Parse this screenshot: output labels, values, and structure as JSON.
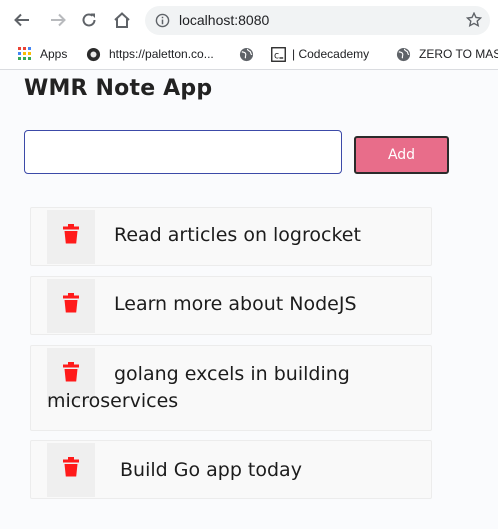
{
  "browser": {
    "url": "localhost:8080",
    "bookmarks": [
      {
        "label": "Apps",
        "icon": "apps-grid-icon"
      },
      {
        "label": "https://paletton.co...",
        "icon": "paletton-icon"
      },
      {
        "label": "",
        "icon": "globe-icon"
      },
      {
        "label": "| Codecademy",
        "icon": "codecademy-icon"
      },
      {
        "label": "ZERO TO MAST",
        "icon": "globe-icon"
      }
    ]
  },
  "app": {
    "title": "WMR Note App",
    "input": {
      "value": "",
      "placeholder": ""
    },
    "add_label": "Add",
    "colors": {
      "add_button": "#e86d8a",
      "delete_icon": "#ff1a1a",
      "input_border": "#3c4aa8"
    }
  },
  "notes": [
    {
      "text": "Read articles on logrocket"
    },
    {
      "text": "Learn more about NodeJS"
    },
    {
      "text": "golang excels in building microservices"
    },
    {
      "text": "Build Go app today"
    }
  ]
}
